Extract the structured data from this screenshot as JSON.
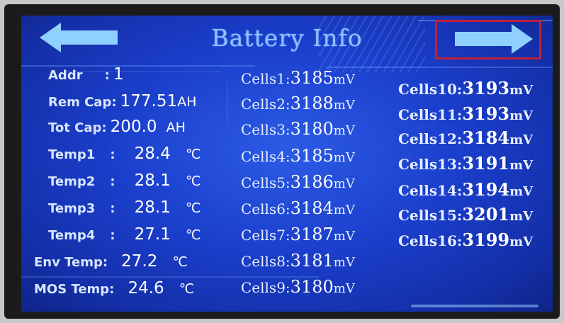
{
  "screen": {
    "title": "Battery Info",
    "nav": {
      "prev_icon": "left-arrow-icon",
      "next_icon": "right-arrow-icon"
    }
  },
  "info": [
    {
      "label": "Addr",
      "sep": ":",
      "value": "1",
      "unit": ""
    },
    {
      "label": "Rem Cap",
      "sep": ":",
      "value": "177.51",
      "unit": "AH"
    },
    {
      "label": "Tot Cap",
      "sep": ":",
      "value": "200.0",
      "unit": "AH"
    },
    {
      "label": "Temp1",
      "sep": ":",
      "value": "28.4",
      "unit": "℃"
    },
    {
      "label": "Temp2",
      "sep": ":",
      "value": "28.1",
      "unit": "℃"
    },
    {
      "label": "Temp3",
      "sep": ":",
      "value": "28.1",
      "unit": "℃"
    },
    {
      "label": "Temp4",
      "sep": ":",
      "value": "27.1",
      "unit": "℃"
    },
    {
      "label": "Env Temp",
      "sep": ":",
      "value": "27.2",
      "unit": "℃"
    },
    {
      "label": "MOS Temp",
      "sep": ":",
      "value": "24.6",
      "unit": "℃"
    }
  ],
  "cells_left": [
    {
      "label": "Cells1:",
      "value": "3185",
      "unit": "mV"
    },
    {
      "label": "Cells2:",
      "value": "3188",
      "unit": "mV"
    },
    {
      "label": "Cells3:",
      "value": "3180",
      "unit": "mV"
    },
    {
      "label": "Cells4:",
      "value": "3185",
      "unit": "mV"
    },
    {
      "label": "Cells5:",
      "value": "3186",
      "unit": "mV"
    },
    {
      "label": "Cells6:",
      "value": "3184",
      "unit": "mV"
    },
    {
      "label": "Cells7:",
      "value": "3187",
      "unit": "mV"
    },
    {
      "label": "Cells8:",
      "value": "3181",
      "unit": "mV"
    },
    {
      "label": "Cells9:",
      "value": "3180",
      "unit": "mV"
    }
  ],
  "cells_right": [
    {
      "label": "Cells10:",
      "value": "3193",
      "unit": "mV"
    },
    {
      "label": "Cells11:",
      "value": "3193",
      "unit": "mV"
    },
    {
      "label": "Cells12:",
      "value": "3184",
      "unit": "mV"
    },
    {
      "label": "Cells13:",
      "value": "3191",
      "unit": "mV"
    },
    {
      "label": "Cells14:",
      "value": "3194",
      "unit": "mV"
    },
    {
      "label": "Cells15:",
      "value": "3201",
      "unit": "mV"
    },
    {
      "label": "Cells16:",
      "value": "3199",
      "unit": "mV"
    }
  ],
  "colors": {
    "screen_bg": "#1b3fcc",
    "title_text": "#8fc4ff",
    "arrow_fill": "#8fd0ff",
    "highlight_box": "#c0203a"
  }
}
